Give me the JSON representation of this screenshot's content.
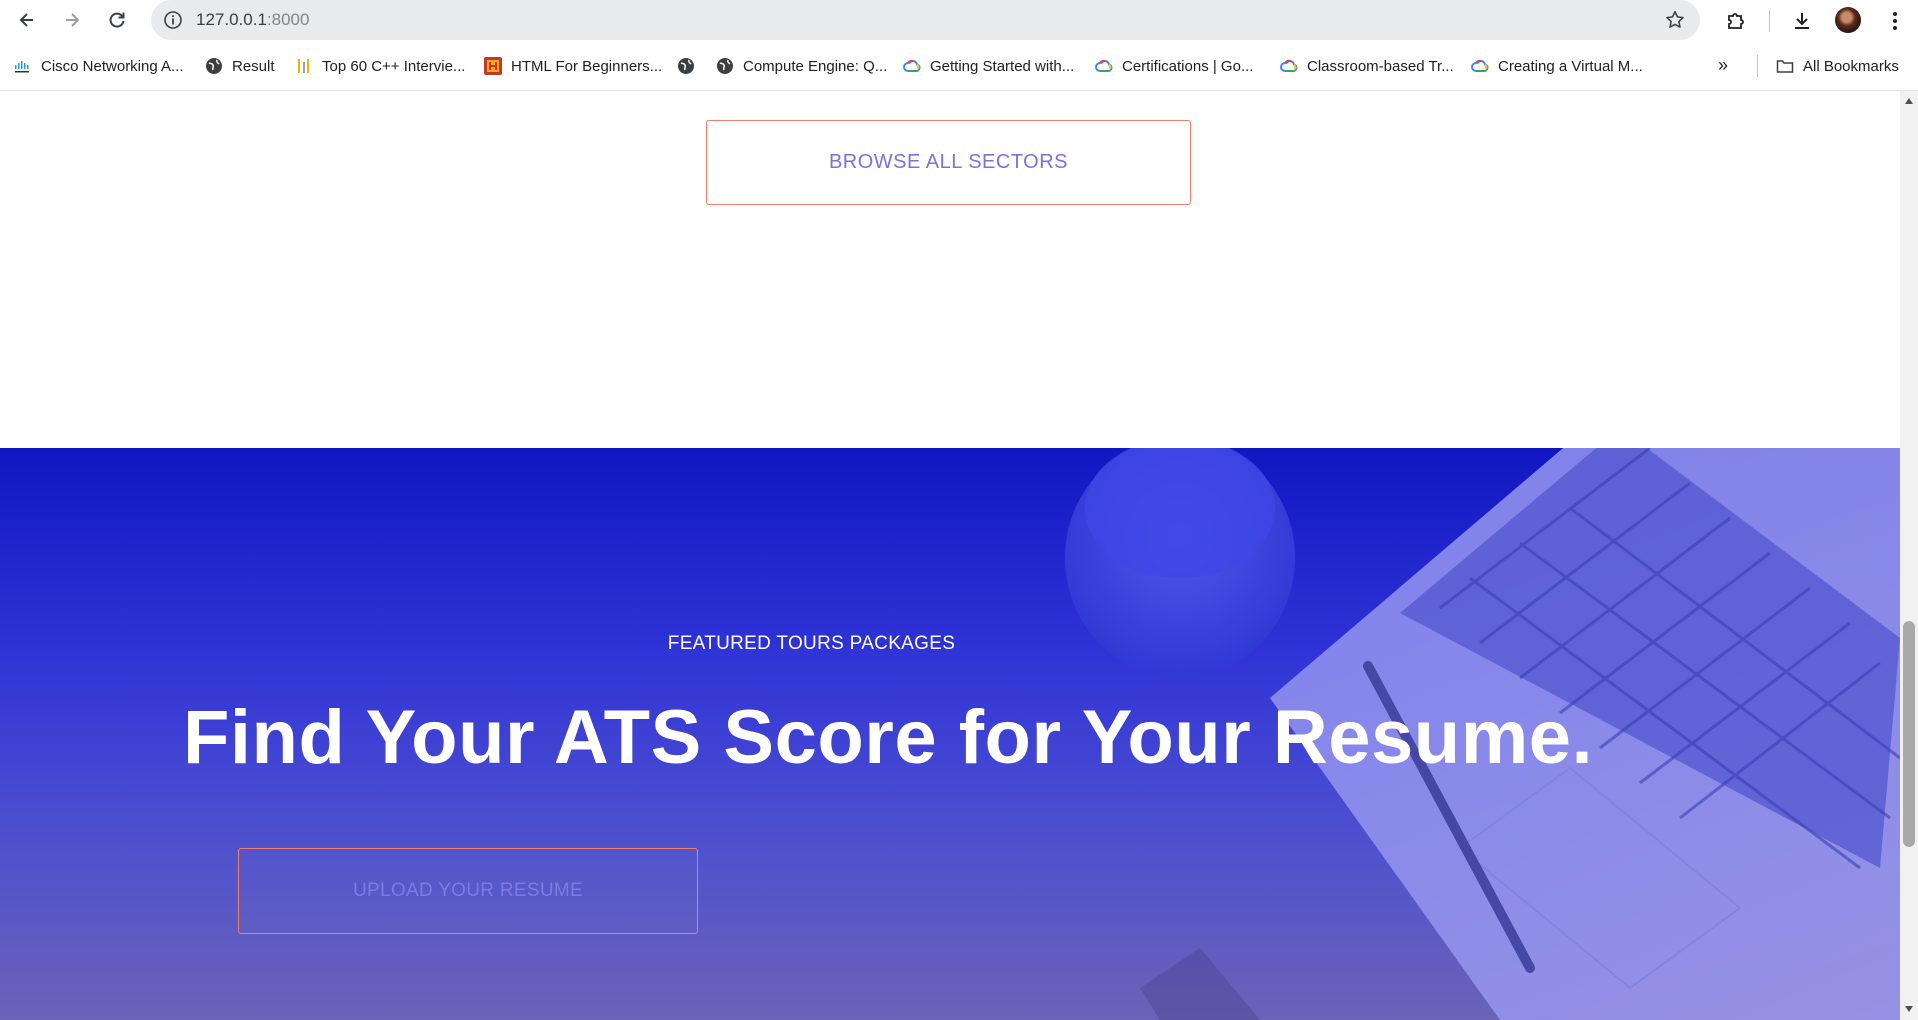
{
  "browser": {
    "url_host": "127.0.0.1",
    "url_port": ":8000",
    "bookmarks": [
      {
        "label": "Cisco Networking A...",
        "icon": "cisco-icon"
      },
      {
        "label": "Result",
        "icon": "globe-icon"
      },
      {
        "label": "Top 60 C++ Intervie...",
        "icon": "bars-icon"
      },
      {
        "label": "HTML For Beginners...",
        "icon": "h-logo-icon"
      },
      {
        "label": "",
        "icon": "globe-icon"
      },
      {
        "label": "Compute Engine: Q...",
        "icon": "globe-icon"
      },
      {
        "label": "Getting Started with...",
        "icon": "google-cloud-icon"
      },
      {
        "label": "Certifications  |  Go...",
        "icon": "google-cloud-icon"
      },
      {
        "label": "Classroom-based Tr...",
        "icon": "google-cloud-icon"
      },
      {
        "label": "Creating a Virtual M...",
        "icon": "google-cloud-icon"
      }
    ],
    "more_bookmarks": "»",
    "all_bookmarks": "All Bookmarks"
  },
  "page": {
    "browse_button": "BROWSE ALL SECTORS",
    "hero": {
      "eyebrow": "FEATURED TOURS PACKAGES",
      "title": "Find Your ATS Score for Your Resume.",
      "upload_button": "UPLOAD YOUR RESUME"
    }
  },
  "colors": {
    "accent_border": "#f0806d",
    "button_text": "#7b72d7",
    "hero_top": "#1017c2",
    "hero_bottom": "#6b63b8"
  }
}
